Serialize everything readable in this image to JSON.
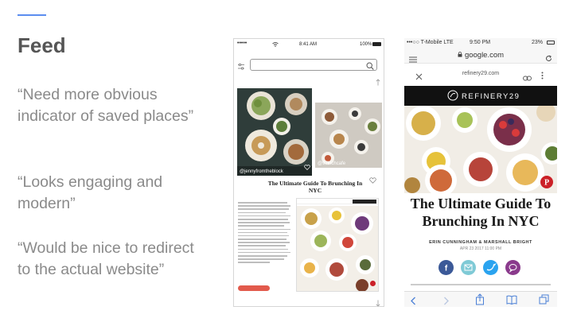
{
  "slide": {
    "title": "Feed",
    "accent_color": "#5b8def",
    "quotes": [
      "“Need more obvious indicator of saved places”",
      "“Looks engaging and modern”",
      "“Would be nice to redirect to the actual website”"
    ]
  },
  "phone1": {
    "status": {
      "signal": "•••••",
      "time": "8:41 AM",
      "battery": "100%"
    },
    "filter_icon": "sliders-icon",
    "search_icon": "search-icon",
    "image_credits": [
      "@jennyfromtheblock",
      "@97inchcafe"
    ],
    "card_title": "The Ultimate Guide To Brunching In NYC",
    "cta_color": "#e25a4c"
  },
  "phone2": {
    "status": {
      "carrier": "•••○○ T-Mobile  LTE",
      "time": "9:50 PM",
      "battery": "23%"
    },
    "url": "google.com",
    "sub_url": "refinery29.com",
    "brand": "REFINERY29",
    "article_title": "The Ultimate Guide To Brunching In NYC",
    "author": "ERIN CUNNINGHAM & MARSHALL BRIGHT",
    "date": "APR 23 2017 11:00 PM",
    "share_colors": [
      "#3b5998",
      "#7fcad6",
      "#2aa3ef",
      "#8a3a8c"
    ],
    "pin_color": "#cb2027"
  }
}
